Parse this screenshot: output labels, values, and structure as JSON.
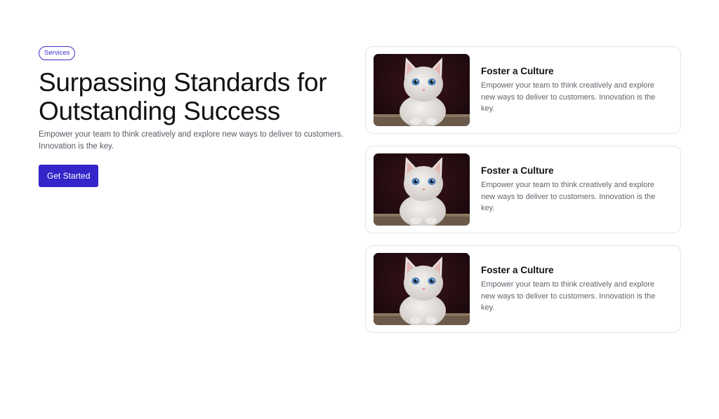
{
  "hero": {
    "badge": "Services",
    "title_line1": "Surpassing Standards for",
    "title_line2": "Outstanding Success",
    "description": "Empower your team to think creatively and explore new ways to deliver to customers. Innovation is the key.",
    "cta_label": "Get Started"
  },
  "cards": [
    {
      "title": "Foster a Culture",
      "text": "Empower your team to think creatively and explore new ways to deliver to customers. Innovation is the key.",
      "image": "kitten-photo"
    },
    {
      "title": "Foster a Culture",
      "text": "Empower your team to think creatively and explore new ways to deliver to customers. Innovation is the key.",
      "image": "kitten-photo"
    },
    {
      "title": "Foster a Culture",
      "text": "Empower your team to think creatively and explore new ways to deliver to customers. Innovation is the key.",
      "image": "kitten-photo"
    }
  ],
  "colors": {
    "accent": "#3325c9",
    "badge_border": "#3b33c8",
    "card_border": "#e3e5ea",
    "body_text": "#555a63"
  }
}
